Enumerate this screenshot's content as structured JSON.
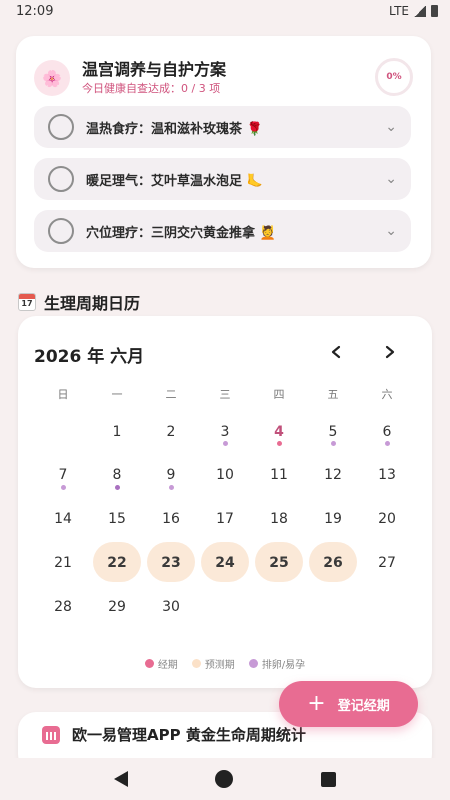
{
  "status": {
    "time": "12:09",
    "network": "LTE"
  },
  "plan": {
    "title": "温宫调养与自护方案",
    "subtitle": "今日健康自查达成：0 / 3 项",
    "progress": "0%",
    "tasks": [
      {
        "label": "温热食疗：温和滋补玫瑰茶 🌹"
      },
      {
        "label": "暖足理气：艾叶草温水泡足 🦶"
      },
      {
        "label": "穴位理疗：三阴交穴黄金推拿 💆"
      }
    ]
  },
  "calendar": {
    "section_title": "生理周期日历",
    "month_label": "2026 年 六月",
    "prev_icon": "chevron-left",
    "next_icon": "chevron-right",
    "weekdays": [
      "日",
      "一",
      "二",
      "三",
      "四",
      "五",
      "六"
    ],
    "days": [
      "1",
      "2",
      "3",
      "4",
      "5",
      "6",
      "7",
      "8",
      "9",
      "10",
      "11",
      "12",
      "13",
      "14",
      "15",
      "16",
      "17",
      "18",
      "19",
      "20",
      "21",
      "22",
      "23",
      "24",
      "25",
      "26",
      "27",
      "28",
      "29",
      "30"
    ],
    "legend": [
      "经期",
      "预测期",
      "排卵/易孕"
    ],
    "colors": {
      "period": "#e86c92",
      "predicted": "#fbe9d8",
      "fertile": "#c79ad6"
    }
  },
  "fab": {
    "label": "登记经期"
  },
  "stats": {
    "title": "欧一易管理APP 黄金生命周期统计"
  }
}
